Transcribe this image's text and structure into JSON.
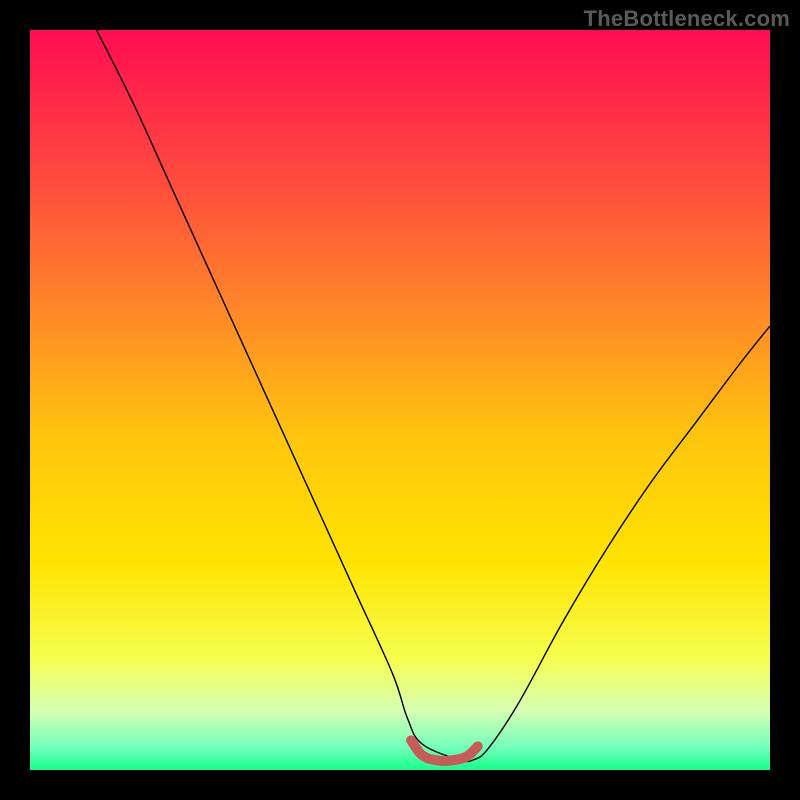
{
  "watermark": {
    "text": "TheBottleneck.com"
  },
  "chart_data": {
    "type": "line",
    "title": "",
    "xlabel": "",
    "ylabel": "",
    "xlim": [
      0,
      100
    ],
    "ylim": [
      0,
      100
    ],
    "grid": false,
    "legend": false,
    "background": {
      "kind": "vertical-gradient",
      "stops": [
        {
          "pos": 0.0,
          "color": "#ff0d52"
        },
        {
          "pos": 0.2,
          "color": "#ff4a3e"
        },
        {
          "pos": 0.4,
          "color": "#ff8f25"
        },
        {
          "pos": 0.55,
          "color": "#ffc50e"
        },
        {
          "pos": 0.72,
          "color": "#ffe400"
        },
        {
          "pos": 0.85,
          "color": "#f6ff50"
        },
        {
          "pos": 0.92,
          "color": "#d6ffb4"
        },
        {
          "pos": 0.97,
          "color": "#72ffba"
        },
        {
          "pos": 1.0,
          "color": "#14ff8a"
        }
      ]
    },
    "series": [
      {
        "name": "bottleneck-curve",
        "kind": "line",
        "stroke": "#000000",
        "stroke_width": 1.4,
        "x": [
          9,
          14,
          19,
          24,
          29,
          34,
          39,
          44,
          49,
          51,
          53,
          58,
          60,
          62,
          66,
          72,
          78,
          84,
          90,
          96,
          100
        ],
        "y": [
          100,
          90,
          79,
          68,
          57,
          46,
          35,
          24,
          13,
          7,
          3.5,
          1.4,
          1.4,
          3,
          9,
          20,
          30,
          39,
          47,
          55,
          60
        ]
      },
      {
        "name": "sweet-spot-band",
        "kind": "line",
        "stroke": "#c85a58",
        "stroke_width": 10,
        "linecap": "round",
        "x": [
          51.5,
          53.0,
          55.0,
          57.0,
          59.0,
          60.5
        ],
        "y": [
          4.0,
          2.0,
          1.3,
          1.3,
          1.8,
          3.2
        ]
      }
    ],
    "annotations": []
  }
}
